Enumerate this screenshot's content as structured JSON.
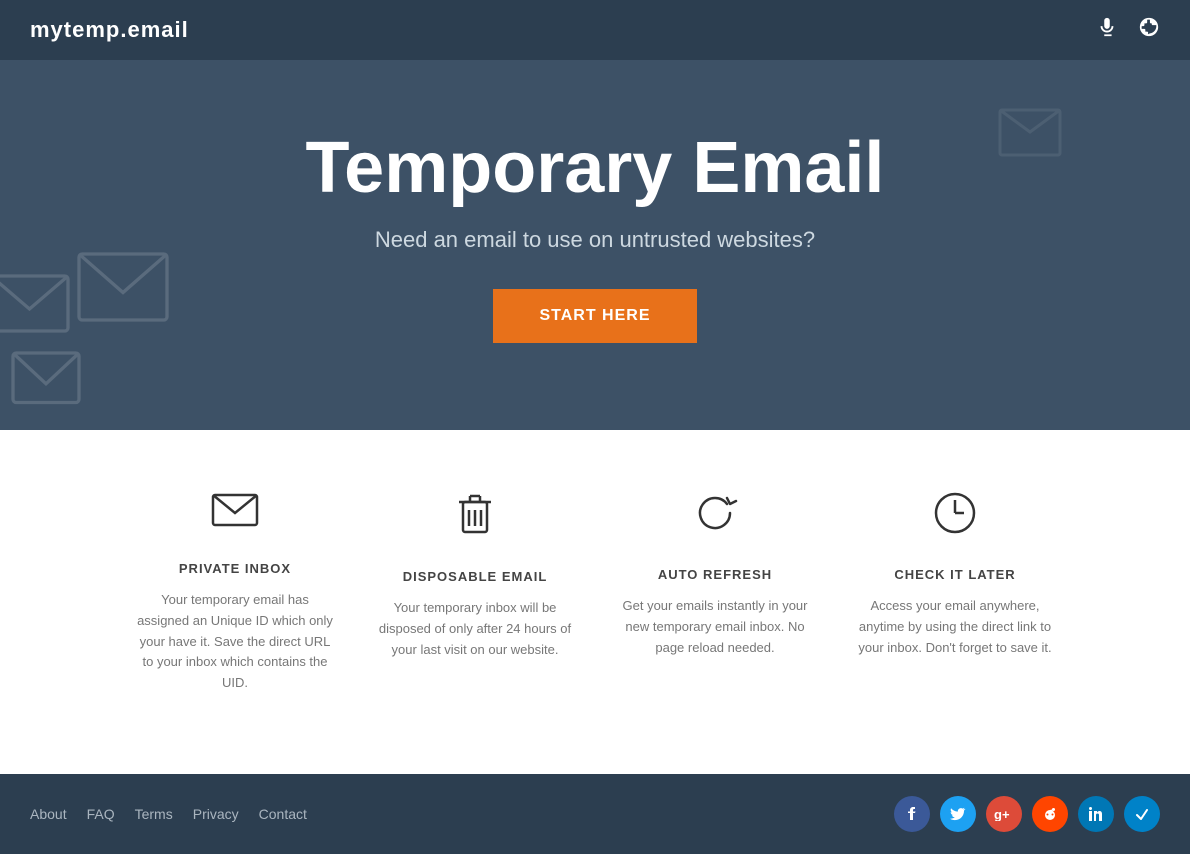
{
  "header": {
    "logo": "mytemp.email",
    "mic_icon": "🎤",
    "globe_icon": "🌐"
  },
  "hero": {
    "title": "Temporary Email",
    "subtitle": "Need an email to use on untrusted websites?",
    "cta_label": "START HERE"
  },
  "features": [
    {
      "id": "private-inbox",
      "title": "PRIVATE INBOX",
      "description": "Your temporary email has assigned an Unique ID which only your have it. Save the direct URL to your inbox which contains the UID.",
      "icon": "✉"
    },
    {
      "id": "disposable-email",
      "title": "DISPOSABLE EMAIL",
      "description": "Your temporary inbox will be disposed of only after 24 hours of your last visit on our website.",
      "icon": "🗑"
    },
    {
      "id": "auto-refresh",
      "title": "AUTO REFRESH",
      "description": "Get your emails instantly in your new temporary email inbox. No page reload needed.",
      "icon": "↻"
    },
    {
      "id": "check-it-later",
      "title": "CHECK IT LATER",
      "description": "Access your email anywhere, anytime by using the direct link to your inbox. Don't forget to save it.",
      "icon": "🕐"
    }
  ],
  "footer": {
    "links": [
      {
        "label": "About",
        "href": "#"
      },
      {
        "label": "FAQ",
        "href": "#"
      },
      {
        "label": "Terms",
        "href": "#"
      },
      {
        "label": "Privacy",
        "href": "#"
      },
      {
        "label": "Contact",
        "href": "#"
      }
    ],
    "social": [
      {
        "name": "facebook",
        "class": "social-fb",
        "symbol": "f"
      },
      {
        "name": "twitter",
        "class": "social-tw",
        "symbol": "t"
      },
      {
        "name": "google-plus",
        "class": "social-gp",
        "symbol": "g+"
      },
      {
        "name": "reddit",
        "class": "social-rd",
        "symbol": "r"
      },
      {
        "name": "linkedin",
        "class": "social-li",
        "symbol": "in"
      },
      {
        "name": "other",
        "class": "social-pk",
        "symbol": "✓"
      }
    ]
  }
}
